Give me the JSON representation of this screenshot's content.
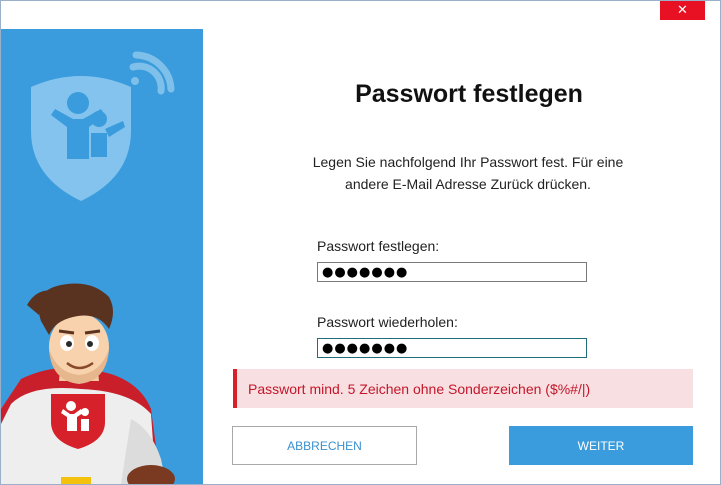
{
  "window": {
    "close_icon": "close-icon"
  },
  "main": {
    "title": "Passwort festlegen",
    "description": "Legen Sie nachfolgend Ihr Passwort fest. Für eine andere E-Mail Adresse Zurück drücken."
  },
  "form": {
    "password_label": "Passwort festlegen:",
    "password_value": "●●●●●●●",
    "repeat_label": "Passwort wiederholen:",
    "repeat_value": "●●●●●●●"
  },
  "error": {
    "message": "Passwort mind. 5 Zeichen ohne Sonderzeichen ($%#/|)"
  },
  "buttons": {
    "cancel_label": "ABBRECHEN",
    "next_label": "WEITER"
  },
  "colors": {
    "accent": "#3a9cdc",
    "error_bg": "#f8e0e2",
    "error_text": "#c4162a",
    "close": "#e81123"
  }
}
